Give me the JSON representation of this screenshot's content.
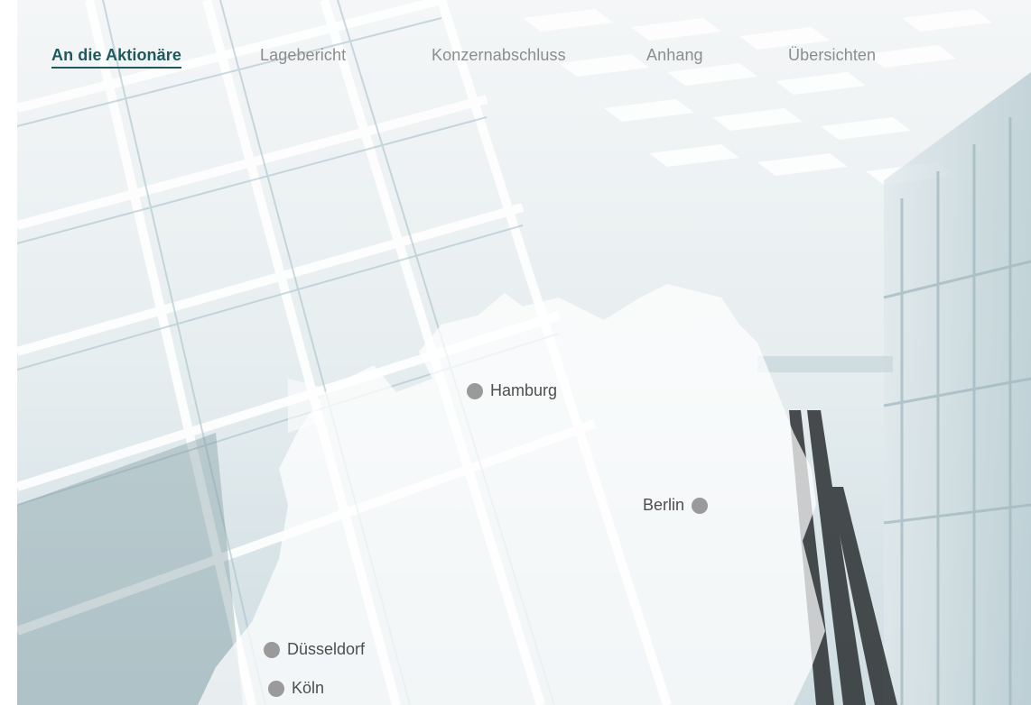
{
  "nav": {
    "items": [
      {
        "label": "An die Aktionäre",
        "active": true
      },
      {
        "label": "Lagebericht",
        "active": false
      },
      {
        "label": "Konzernabschluss",
        "active": false
      },
      {
        "label": "Anhang",
        "active": false
      },
      {
        "label": "Übersichten",
        "active": false
      }
    ]
  },
  "map": {
    "cities": {
      "hamburg": "Hamburg",
      "berlin": "Berlin",
      "duesseldorf": "Düsseldorf",
      "koeln": "Köln"
    }
  },
  "colors": {
    "accent": "#1e5a5c",
    "nav_inactive": "#8d8d8d",
    "city_dot": "#9a9a9a",
    "city_text": "#4e4e4e"
  }
}
